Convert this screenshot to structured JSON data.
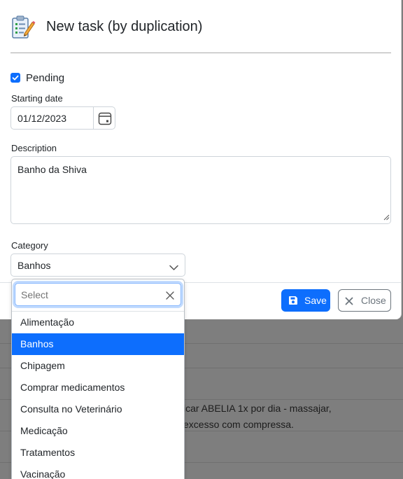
{
  "modal": {
    "title": "New task (by duplication)",
    "icon": "task-list-pencil-icon",
    "pending_label": "Pending",
    "pending_checked": true,
    "starting_date_label": "Starting date",
    "starting_date_value": "01/12/2023",
    "description_label": "Description",
    "description_value": "Banho da Shiva",
    "category_label": "Category",
    "category_value": "Banhos",
    "save_label": "Save",
    "close_label": "Close"
  },
  "dropdown": {
    "search_placeholder": "Select",
    "selected": "Banhos",
    "options": [
      "Alimentação",
      "Banhos",
      "Chipagem",
      "Comprar medicamentos",
      "Consulta no Veterinário",
      "Medicação",
      "Tratamentos",
      "Vacinação"
    ]
  },
  "background": {
    "line1": "icar ABELIA 1x por dia - massajar,",
    "line2": "excesso com compressa."
  },
  "colors": {
    "primary": "#0d6efd",
    "secondary": "#6c757d",
    "overlay": "#7e7e7e"
  }
}
